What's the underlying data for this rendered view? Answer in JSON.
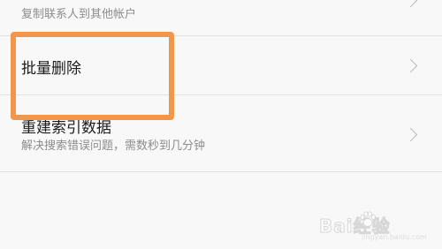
{
  "settings_list": {
    "items": [
      {
        "title": "",
        "subtitle": "复制联系人到其他帐户"
      },
      {
        "title": "批量删除",
        "subtitle": ""
      },
      {
        "title": "重建索引数据",
        "subtitle": "解决搜索错误问题，需数秒到几分钟"
      }
    ]
  },
  "annotation": {
    "highlight_color": "#f0974b"
  },
  "watermark": {
    "brand": "Bai经验",
    "url": "jingyan.baidu.com"
  },
  "icons": {
    "chevron": "chevron-right-icon",
    "paw": "paw-icon"
  }
}
